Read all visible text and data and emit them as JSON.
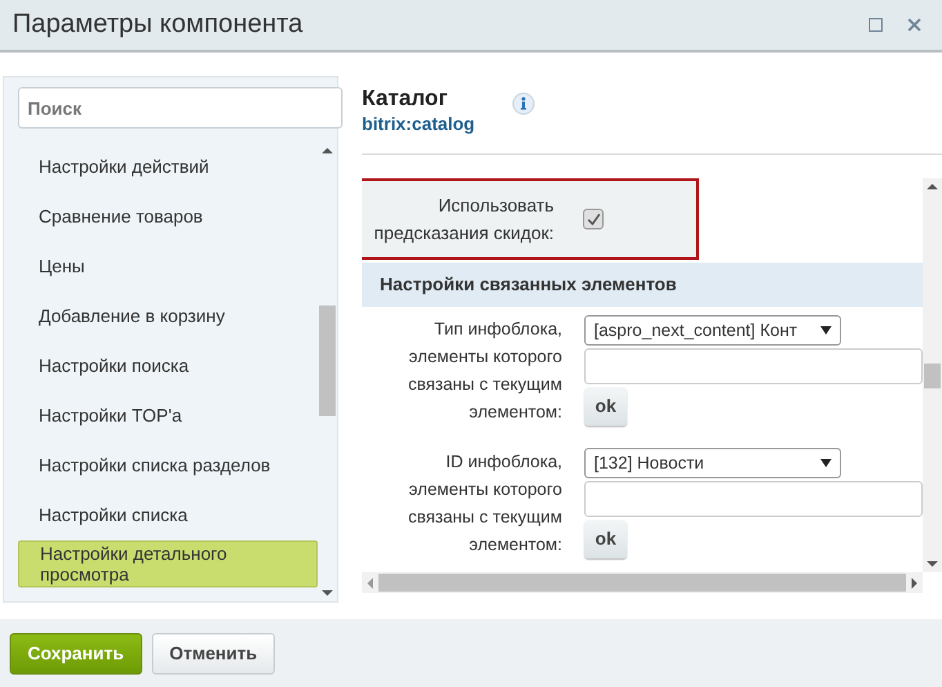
{
  "window": {
    "title": "Параметры компонента"
  },
  "sidebar": {
    "search": {
      "placeholder": "Поиск"
    },
    "items": [
      {
        "label": "Настройки действий",
        "selected": false
      },
      {
        "label": "Сравнение товаров",
        "selected": false
      },
      {
        "label": "Цены",
        "selected": false
      },
      {
        "label": "Добавление в корзину",
        "selected": false
      },
      {
        "label": "Настройки поиска",
        "selected": false
      },
      {
        "label": "Настройки TOP'а",
        "selected": false
      },
      {
        "label": "Настройки списка разделов",
        "selected": false
      },
      {
        "label": "Настройки списка",
        "selected": false
      },
      {
        "label": "Настройки детального просмотра",
        "selected": true
      }
    ]
  },
  "component": {
    "name": "Каталог",
    "code": "bitrix:catalog"
  },
  "discount_option": {
    "label": "Использовать предсказания скидок:",
    "checked": true
  },
  "section": {
    "title": "Настройки связанных элементов"
  },
  "fields": [
    {
      "label": "Тип инфоблока, элементы которого связаны с текущим элементом:",
      "select": "[aspro_next_content] Конт",
      "button": "ok"
    },
    {
      "label": "ID инфоблока, элементы которого связаны с текущим элементом:",
      "select": "[132] Новости",
      "button": "ok"
    }
  ],
  "buttons": [
    {
      "label": "Сохранить",
      "kind": "primary"
    },
    {
      "label": "Отменить",
      "kind": "secondary"
    }
  ]
}
